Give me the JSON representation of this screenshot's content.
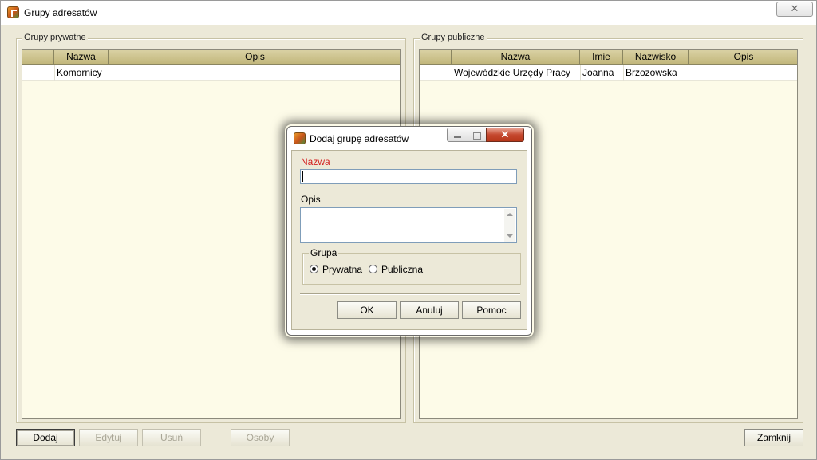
{
  "window": {
    "title": "Grupy adresatów",
    "close_glyph": "✕"
  },
  "private_groups": {
    "legend": "Grupy prywatne",
    "columns": [
      "",
      "Nazwa",
      "Opis"
    ],
    "rows": [
      {
        "nazwa": "Komornicy",
        "opis": ""
      }
    ]
  },
  "public_groups": {
    "legend": "Grupy publiczne",
    "columns": [
      "",
      "Nazwa",
      "Imie",
      "Nazwisko",
      "Opis"
    ],
    "rows": [
      {
        "nazwa": "Wojewódzkie Urzędy Pracy",
        "imie": "Joanna",
        "nazwisko": "Brzozowska",
        "opis": ""
      }
    ]
  },
  "bottom_buttons": {
    "add": "Dodaj",
    "edit": "Edytuj",
    "delete": "Usuń",
    "persons": "Osoby",
    "close": "Zamknij"
  },
  "dialog": {
    "title": "Dodaj grupę adresatów",
    "close_glyph": "✕",
    "name_label": "Nazwa",
    "name_value": "",
    "desc_label": "Opis",
    "desc_value": "",
    "group_legend": "Grupa",
    "radio_private": "Prywatna",
    "radio_public": "Publiczna",
    "selected_group": "Prywatna",
    "ok": "OK",
    "cancel": "Anuluj",
    "help": "Pomoc"
  },
  "colors": {
    "required_label": "#d41f1f",
    "header_bg": "#c9bf88",
    "grid_bg": "#fdfbe8",
    "window_bg": "#ece9d8"
  }
}
